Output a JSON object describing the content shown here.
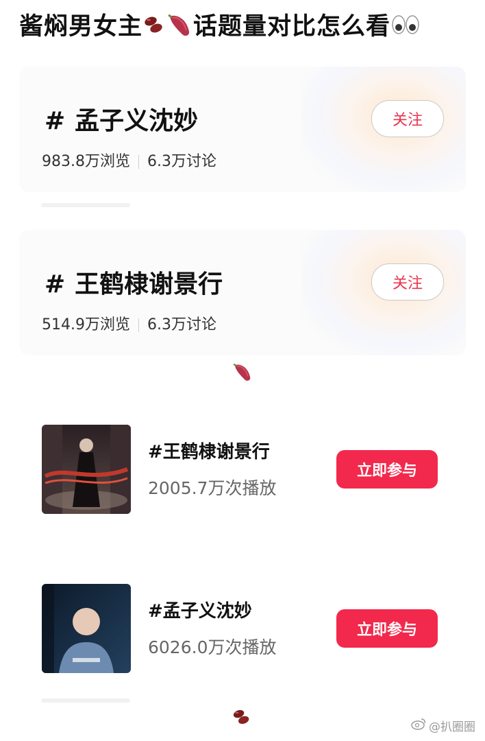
{
  "title": "酱焖男女主",
  "title_suffix": "话题量对比怎么看",
  "topics": [
    {
      "hash": "#",
      "name": "孟子义沈妙",
      "views": "983.8万浏览",
      "discussions": "6.3万讨论",
      "follow_label": "关注"
    },
    {
      "hash": "#",
      "name": "王鹤棣谢景行",
      "views": "514.9万浏览",
      "discussions": "6.3万讨论",
      "follow_label": "关注"
    }
  ],
  "videos": [
    {
      "title": "#王鹤棣谢景行",
      "plays": "2005.7万次播放",
      "join_label": "立即参与"
    },
    {
      "title": "#孟子义沈妙",
      "plays": "6026.0万次播放",
      "join_label": "立即参与"
    }
  ],
  "watermark": "@扒圈圈",
  "colors": {
    "accent_red": "#f2294c",
    "follow_text": "#e8354f"
  },
  "icons": [
    "beans-icon",
    "sweet-potato-icon",
    "eyes-icon",
    "weibo-icon"
  ]
}
